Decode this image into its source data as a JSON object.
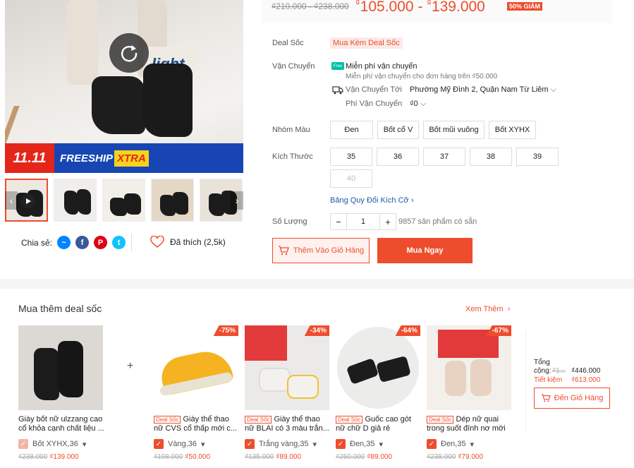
{
  "price": {
    "old": "₫210.000 - ₫238.000",
    "new_low": "105.000",
    "new_high": "139.000",
    "currency": "₫",
    "separator": "-",
    "discount": "50% GIẢM"
  },
  "deal": {
    "label": "Deal Sốc",
    "tag": "Mua Kèm Deal Sốc"
  },
  "shipping": {
    "label": "Vận Chuyển",
    "free_title": "Miễn phí vận chuyển",
    "free_note": "Miễn phí vận chuyển cho đơn hàng trên ₫50.000",
    "to_label": "Vận Chuyển Tới",
    "to_value": "Phường Mỹ Đình 2, Quận Nam Từ Liêm",
    "fee_label": "Phí Vận Chuyển",
    "fee_value": "₫0",
    "free_icon_text": "Free"
  },
  "color_group": {
    "label": "Nhóm Màu",
    "options": [
      "Đen",
      "Bốt cổ V",
      "Bốt mũi vuông",
      "Bốt XYHX"
    ]
  },
  "size": {
    "label": "Kích Thước",
    "options": [
      "35",
      "36",
      "37",
      "38",
      "39",
      "40"
    ],
    "guide": "Bảng Quy Đổi Kích Cỡ"
  },
  "quantity": {
    "label": "Số Lượng",
    "value": "1",
    "minus": "−",
    "plus": "+",
    "stock": "9857 sản phẩm có sẵn"
  },
  "actions": {
    "add_cart": "Thêm Vào Giỏ Hàng",
    "buy_now": "Mua Ngay"
  },
  "share": {
    "label": "Chia sẻ:",
    "liked": "Đã thích (2,5k)"
  },
  "banner": {
    "left": "11.11",
    "mid": "FREESHIP",
    "right": "XTRA"
  },
  "image_text": "light",
  "bundle": {
    "title": "Mua thêm deal sốc",
    "see_more": "Xem Thêm",
    "deal_tag": "Deal Sốc",
    "products": [
      {
        "name": "Giày bốt nữ ulzzang cao cổ khỏa cạnh chất liệu ...",
        "variant": "Bốt XYHX,36",
        "old": "₫238.000",
        "price": "₫139.000",
        "badge": ""
      },
      {
        "name": "Giày thể thao nữ CVS cổ thấp mới c...",
        "variant": "Vàng,36",
        "old": "₫198.000",
        "price": "₫50.000",
        "badge": "-75%"
      },
      {
        "name": "Giày thể thao nữ BLAI có 3 màu trắn...",
        "variant": "Trắng vàng,35",
        "old": "₫135.000",
        "price": "₫89.000",
        "badge": "-34%"
      },
      {
        "name": "Guốc cao gót nữ chữ D giả rẻ",
        "variant": "Đen,35",
        "old": "₫250.000",
        "price": "₫89.000",
        "badge": "-64%"
      },
      {
        "name": "Dép nữ quai trong suốt đính nơ mới",
        "variant": "Đen,35",
        "old": "₫238.000",
        "price": "₫79.000",
        "badge": "-67%"
      }
    ],
    "total_label": "Tổng cộng:",
    "total_old": "₫1...",
    "total_new": "₫446.000",
    "save_label": "Tiết kiệm",
    "save_value": "₫613.000",
    "go_cart": "Đến Giỏ Hàng"
  }
}
